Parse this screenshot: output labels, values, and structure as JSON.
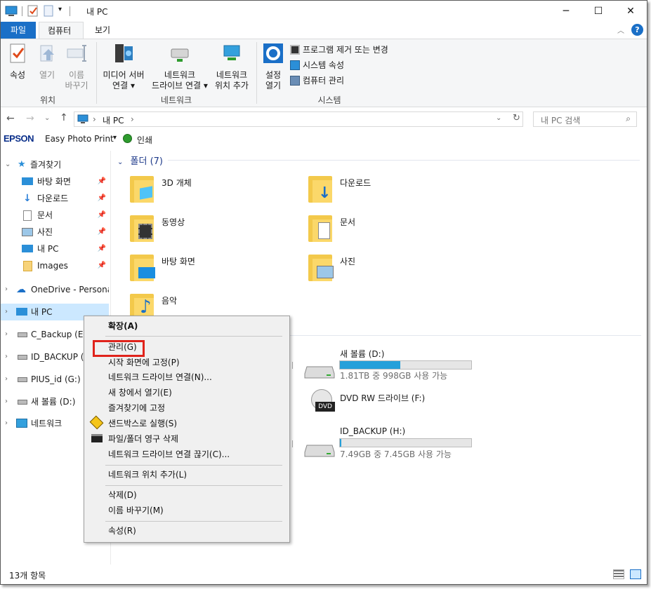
{
  "window": {
    "title": "내 PC"
  },
  "tabs": {
    "file": "파일",
    "computer": "컴퓨터",
    "view": "보기"
  },
  "ribbon": {
    "location": {
      "properties": "속성",
      "open": "열기",
      "rename_1": "이름",
      "rename_2": "바꾸기",
      "label": "위치"
    },
    "network": {
      "media_1": "미디어 서버",
      "media_2": "연결",
      "map_1": "네트워크",
      "map_2": "드라이브 연결",
      "add_1": "네트워크",
      "add_2": "위치 추가",
      "label": "네트워크"
    },
    "system": {
      "settings_1": "설정",
      "settings_2": "열기",
      "uninstall": "프로그램 제거 또는 변경",
      "sysprops": "시스템 속성",
      "manage": "컴퓨터 관리",
      "label": "시스템"
    }
  },
  "address": {
    "path": "내 PC",
    "search_placeholder": "내 PC 검색"
  },
  "epson": {
    "brand": "EPSON",
    "app": "Easy Photo Print",
    "print": "인쇄"
  },
  "nav": {
    "quick_access": "즐겨찾기",
    "quick_items": [
      "바탕 화면",
      "다운로드",
      "문서",
      "사진",
      "내 PC",
      "Images"
    ],
    "onedrive": "OneDrive - Personal",
    "this_pc": "내 PC",
    "drives": [
      "C_Backup (E:)",
      "ID_BACKUP (H:)",
      "PIUS_id (G:)",
      "새 볼륨 (D:)"
    ],
    "network": "네트워크"
  },
  "content": {
    "folders_header": "폴더 (7)",
    "folders": [
      "3D 개체",
      "다운로드",
      "동영상",
      "문서",
      "바탕 화면",
      "사진",
      "음악"
    ],
    "drives": [
      {
        "name": "새 볼륨 (D:)",
        "info": "1.81TB 중 998GB 사용 가능",
        "used_fraction": 0.46
      },
      {
        "name": "DVD RW 드라이브 (F:)",
        "info": ""
      },
      {
        "name": "ID_BACKUP (H:)",
        "info": "7.49GB 중 7.45GB 사용 가능",
        "used_fraction": 0.01
      }
    ]
  },
  "context_menu": {
    "items": [
      "확장(A)",
      "관리(G)",
      "시작 화면에 고정(P)",
      "네트워크 드라이브 연결(N)...",
      "새 창에서 열기(E)",
      "즐겨찾기에 고정",
      "샌드박스로 실행(S)",
      "파일/폴더 영구 삭제",
      "네트워크 드라이브 연결 끊기(C)...",
      "네트워크 위치 추가(L)",
      "삭제(D)",
      "이름 바꾸기(M)",
      "속성(R)"
    ]
  },
  "status": {
    "count": "13개 항목"
  },
  "colors": {
    "accent": "#1a6fc7",
    "selection": "#cce8ff",
    "highlight": "#e0231b",
    "progress": "#26a0da"
  }
}
